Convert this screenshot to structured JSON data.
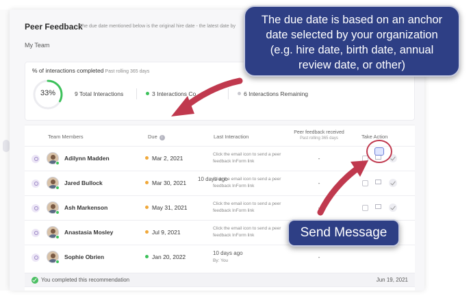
{
  "header": {
    "title": "Peer Feedback",
    "subtitle": "The due date mentioned below is the original hire date - the latest date by"
  },
  "team_link": "My Team",
  "stats": {
    "label": "% of interactions completed",
    "label_sub": "Past rolling 365 days",
    "percent_text": "33%",
    "percent": 0.33,
    "total": "9 Total Interactions",
    "completed": "3 Interactions Co",
    "remaining": "6 Interactions Remaining",
    "completed_color": "#3cc15a",
    "remaining_color": "#c9c9d0"
  },
  "table": {
    "columns": {
      "members": "Team Members",
      "due": "Due",
      "last": "Last Interaction",
      "received": "Peer feedback received",
      "received_sub": "Past rolling 365 days",
      "action": "Take Action"
    },
    "rows": [
      {
        "name": "Adilynn Madden",
        "due": "Mar 2, 2021",
        "due_color": "#f0a83a",
        "last": "Click the email icon to send a peer feedback InForm link",
        "received": "-"
      },
      {
        "name": "Jared Bullock",
        "due": "Mar 30, 2021",
        "due_color": "#f0a83a",
        "last": "Click the email icon to send a peer feedback InForm link",
        "received": "-"
      },
      {
        "name": "Ash Markenson",
        "due": "May 31, 2021",
        "due_color": "#f0a83a",
        "last": "Click the email icon to send a peer feedback InForm link",
        "received": "-"
      },
      {
        "name": "Anastasia Mosley",
        "due": "Jul 9, 2021",
        "due_color": "#f0a83a",
        "last": "Click the email icon to send a peer feedback InForm link",
        "received": "-"
      },
      {
        "name": "Sophie Obrien",
        "due": "Jan 20, 2022",
        "due_color": "#3cc15a",
        "last": "10 days ago",
        "last_by": "By: You",
        "received": "-"
      }
    ],
    "completed_note": "You completed this recommendation",
    "completed_date": "Jun 19, 2021",
    "tail_text": "10 days ago"
  },
  "annotations": {
    "callout": "The due date is based on an anchor date selected by your organization (e.g. hire date, birth date, annual review date, or other)",
    "send_message": "Send Message",
    "arrow_color": "#c0394e",
    "box_color": "#2e3f85"
  }
}
